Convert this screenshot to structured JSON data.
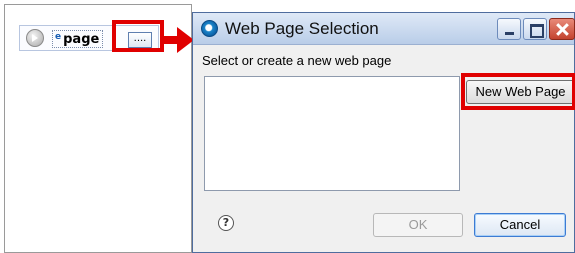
{
  "editor": {
    "node_icon": "circle-play-icon",
    "attr_glyph": "e",
    "node_label": "page",
    "browse_label": "...."
  },
  "dialog": {
    "title": "Web Page Selection",
    "app_icon": "web-page-icon",
    "instruction": "Select or create a new web page",
    "page_list": [],
    "new_page_label": "New Web Page",
    "help_icon": "?",
    "ok_label": "OK",
    "cancel_label": "Cancel",
    "window_buttons": [
      "minimize",
      "maximize",
      "close"
    ]
  },
  "annotations": {
    "highlight_color": "#e00000"
  }
}
